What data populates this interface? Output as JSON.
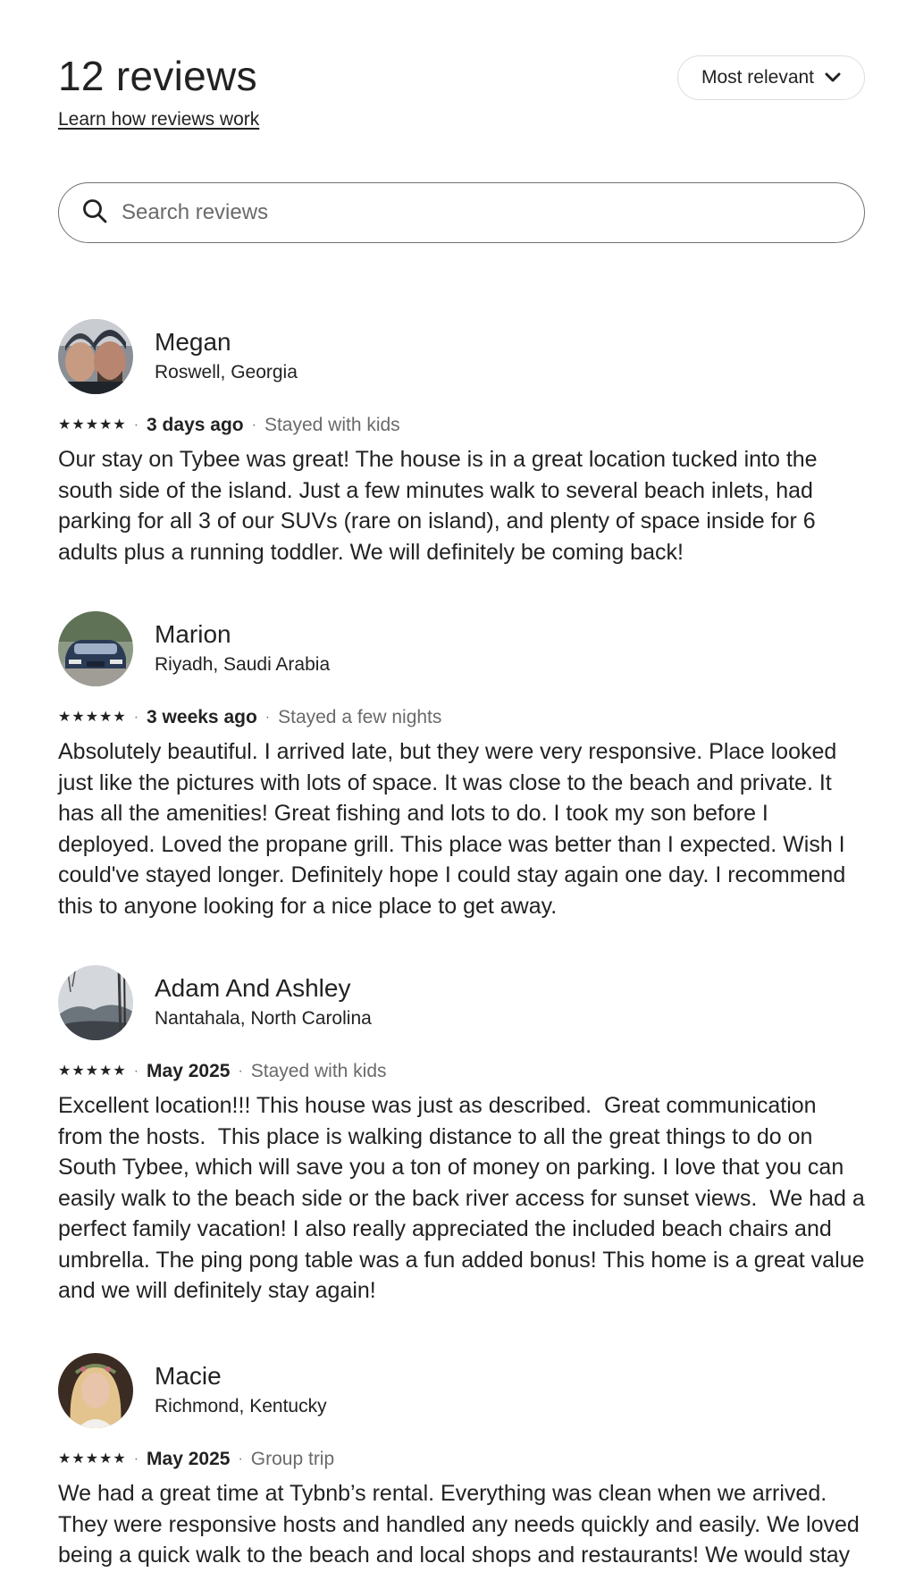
{
  "header": {
    "title": "12 reviews",
    "learn_link": "Learn how reviews work",
    "sort_label": "Most relevant"
  },
  "search": {
    "placeholder": "Search reviews"
  },
  "reviews": [
    {
      "name": "Megan",
      "location": "Roswell, Georgia",
      "rating": 5,
      "date": "3 days ago",
      "trip_type": "Stayed with kids",
      "text": "Our stay on Tybee was great! The house is in a great location tucked into the south side of the island. Just a few minutes walk to several beach inlets, had parking for all 3 of our SUVs (rare on island), and plenty of space inside for 6 adults plus a running toddler. We will definitely be coming back!"
    },
    {
      "name": "Marion",
      "location": "Riyadh, Saudi Arabia",
      "rating": 5,
      "date": "3 weeks ago",
      "trip_type": "Stayed a few nights",
      "text": "Absolutely beautiful. I arrived late, but they were very responsive. Place looked just like the pictures with lots of space. It was close to the beach and private. It has all the amenities! Great fishing and lots to do. I took my son before I deployed. Loved the propane grill. This place was better than I expected. Wish I could've stayed longer. Definitely hope I could stay again one day. I recommend this to anyone looking for a nice place to get away."
    },
    {
      "name": "Adam And Ashley",
      "location": "Nantahala, North Carolina",
      "rating": 5,
      "date": "May 2025",
      "trip_type": "Stayed with kids",
      "text": "Excellent location!!! This house was just as described.  Great communication from the hosts.  This place is walking distance to all the great things to do on South Tybee, which will save you a ton of money on parking. I love that you can easily walk to the beach side or the back river access for sunset views.  We had a perfect family vacation! I also really appreciated the included beach chairs and umbrella. The ping pong table was a fun added bonus! This home is a great value and we will definitely stay again!"
    },
    {
      "name": "Macie",
      "location": "Richmond, Kentucky",
      "rating": 5,
      "date": "May 2025",
      "trip_type": "Group trip",
      "text": "We had a great time at Tybnb’s rental. Everything was clean when we arrived. They were responsive hosts and handled any needs quickly and easily. We loved being a quick walk to the beach and local shops and restaurants! We would stay"
    }
  ]
}
